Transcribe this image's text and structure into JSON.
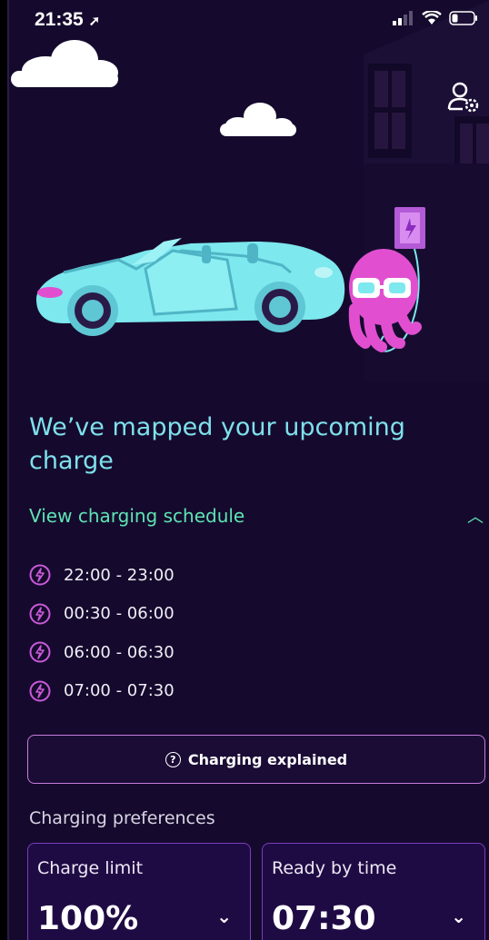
{
  "status_bar": {
    "time": "21:35"
  },
  "headline": "We’ve mapped your upcoming charge",
  "schedule": {
    "toggle_label": "View charging schedule",
    "slots": [
      "22:00 - 23:00",
      "00:30 - 06:00",
      "06:00 - 06:30",
      "07:00 - 07:30"
    ]
  },
  "explained_button": {
    "label": "Charging explained"
  },
  "preferences": {
    "section_label": "Charging preferences",
    "charge_limit": {
      "title": "Charge limit",
      "value": "100%"
    },
    "ready_by": {
      "title": "Ready by time",
      "value": "07:30"
    }
  },
  "colors": {
    "background": "#150a2d",
    "headline": "#7fe0ec",
    "accent_green": "#5fe3b4",
    "bolt": "#c95ad8",
    "card_border": "#7a3cc0",
    "car": "#7de8ee",
    "octopus": "#e14fd0"
  }
}
